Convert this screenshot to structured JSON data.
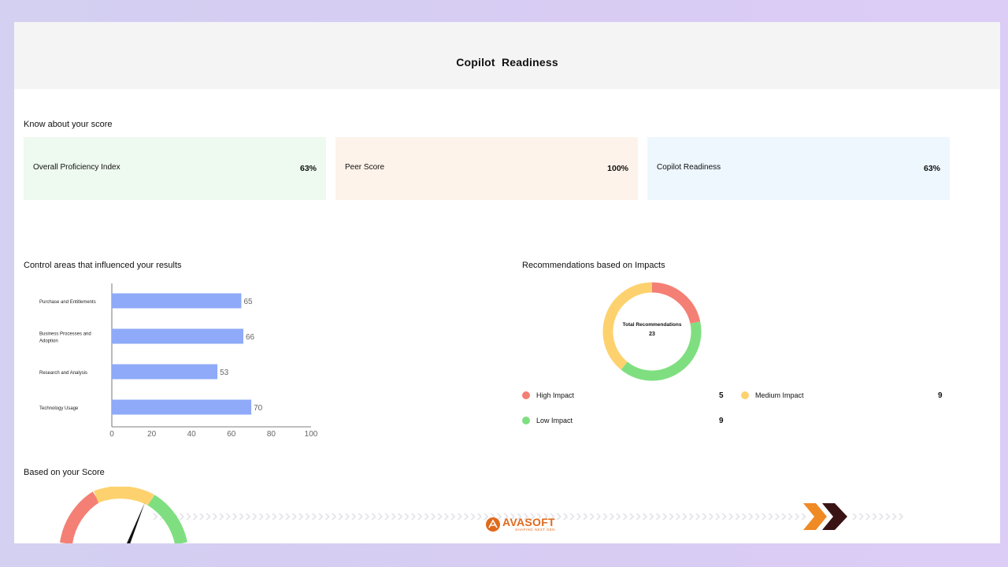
{
  "header": {
    "title": "Copilot  Readiness"
  },
  "score_section": {
    "title": "Know about your score",
    "cards": [
      {
        "label": "Overall Proficiency Index",
        "value": "63%"
      },
      {
        "label": "Peer Score",
        "value": "100%"
      },
      {
        "label": "Copilot Readiness",
        "value": "63%"
      }
    ]
  },
  "control_section": {
    "title": "Control areas that influenced your results"
  },
  "recommendations": {
    "title": "Recommendations based on Impacts",
    "center_label": "Total Recommendations",
    "center_value": "23",
    "legend": [
      {
        "label": "High Impact",
        "count": "5",
        "color": "#f47f74"
      },
      {
        "label": "Medium Impact",
        "count": "9",
        "color": "#fdd26e"
      },
      {
        "label": "Low Impact",
        "count": "9",
        "color": "#7fdf80"
      }
    ]
  },
  "based_section": {
    "title": "Based on your Score"
  },
  "logo": {
    "name": "AVASOFT",
    "tagline": "SHAPING NEXT GEN"
  },
  "colors": {
    "bar": "#8eaaf8",
    "high": "#f47f74",
    "medium": "#fdd26e",
    "low": "#7fdf80",
    "arrow_orange": "#f08a24",
    "arrow_dark": "#3a1414"
  },
  "chart_data": [
    {
      "type": "bar",
      "orientation": "horizontal",
      "categories": [
        "Purchase and Entitlements",
        "Business Processes and Adoption",
        "Research and Analysis",
        "Technology Usage"
      ],
      "values": [
        65,
        66,
        53,
        70
      ],
      "xlim": [
        0,
        100
      ],
      "xticks": [
        0,
        20,
        40,
        60,
        80,
        100
      ],
      "title": "",
      "xlabel": "",
      "ylabel": ""
    },
    {
      "type": "pie",
      "variant": "donut",
      "categories": [
        "High Impact",
        "Low Impact",
        "Medium Impact"
      ],
      "values": [
        5,
        9,
        9
      ],
      "title": ""
    }
  ]
}
